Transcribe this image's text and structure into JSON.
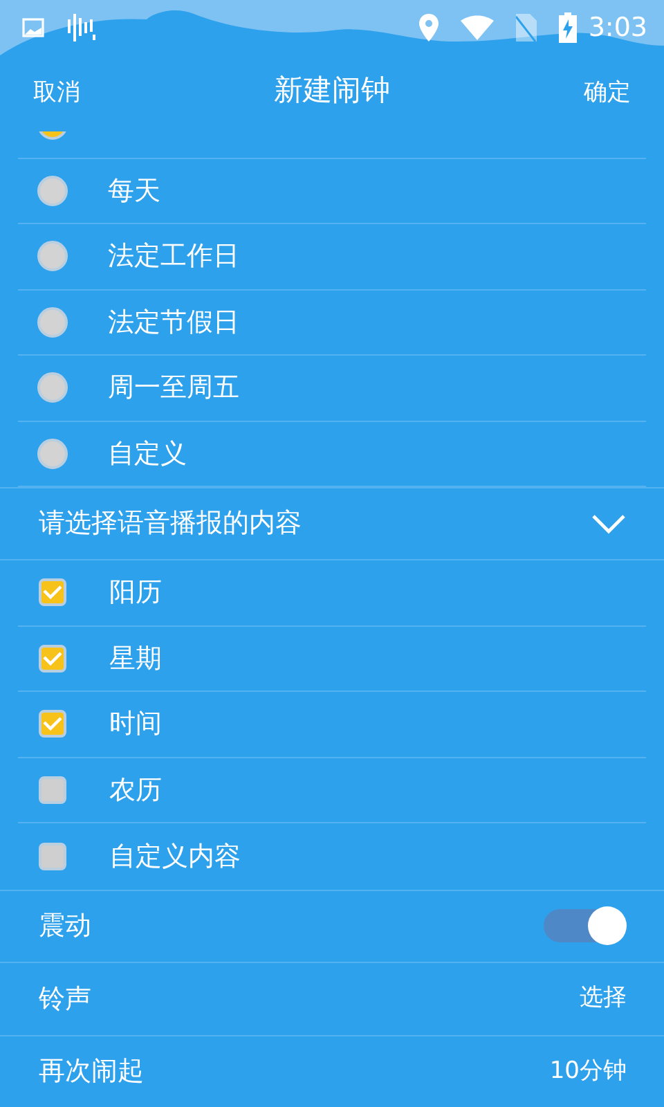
{
  "status_bar": {
    "time": "3:03"
  },
  "header": {
    "cancel": "取消",
    "title": "新建闹钟",
    "confirm": "确定"
  },
  "repeat_options": [
    {
      "selected": true
    },
    {
      "label": "每天",
      "selected": false
    },
    {
      "label": "法定工作日",
      "selected": false
    },
    {
      "label": "法定节假日",
      "selected": false
    },
    {
      "label": "周一至周五",
      "selected": false
    },
    {
      "label": "自定义",
      "selected": false
    }
  ],
  "broadcast": {
    "title": "请选择语音播报的内容",
    "expanded": true,
    "items": [
      {
        "label": "阳历",
        "checked": true
      },
      {
        "label": "星期",
        "checked": true
      },
      {
        "label": "时间",
        "checked": true
      },
      {
        "label": "农历",
        "checked": false
      },
      {
        "label": "自定义内容",
        "checked": false
      }
    ]
  },
  "settings": [
    {
      "kind": "toggle",
      "label": "震动",
      "on": true
    },
    {
      "kind": "value",
      "label": "铃声",
      "value": "选择"
    },
    {
      "kind": "value",
      "label": "再次闹起",
      "value": "10分钟"
    }
  ]
}
